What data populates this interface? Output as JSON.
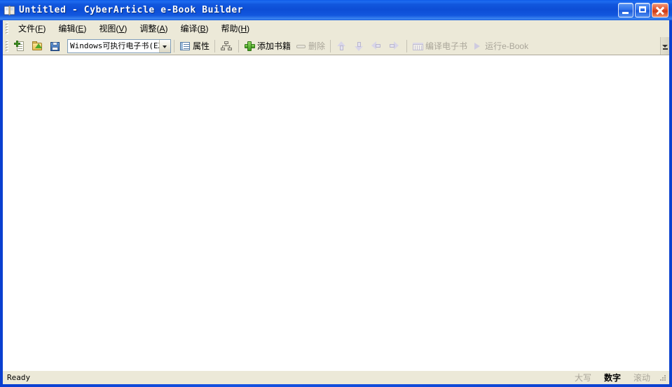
{
  "window": {
    "title": "Untitled - CyberArticle e-Book Builder",
    "icon": "book-icon",
    "caption_buttons": [
      {
        "name": "minimize",
        "label": "_"
      },
      {
        "name": "maximize",
        "label": "□"
      },
      {
        "name": "close",
        "label": "✕"
      }
    ],
    "frame_color": "#0a46d2",
    "face_color": "#ece9d8"
  },
  "menubar": {
    "items": [
      {
        "text": "文件",
        "accel": "F"
      },
      {
        "text": "编辑",
        "accel": "E"
      },
      {
        "text": "视图",
        "accel": "V"
      },
      {
        "text": "调整",
        "accel": "A"
      },
      {
        "text": "编译",
        "accel": "B"
      },
      {
        "text": "帮助",
        "accel": "H"
      }
    ]
  },
  "toolbar": {
    "new_label": "",
    "open_label": "",
    "save_label": "",
    "format_combo": {
      "value": "Windows可执行电子书(EX",
      "placeholder": "Windows可执行电子书(EXE)"
    },
    "properties_label": "属性",
    "hierarchy_label": "",
    "add_book_label": "添加书籍",
    "delete_label": "删除",
    "move_up_label": "",
    "move_down_label": "",
    "move_left_label": "",
    "move_right_label": "",
    "compile_label": "编译电子书",
    "run_label": "运行e-Book",
    "overflow_label": ""
  },
  "workarea": {
    "content": ""
  },
  "statusbar": {
    "message": "Ready",
    "caps": "大写",
    "num": "数字",
    "scroll": "滚动"
  }
}
